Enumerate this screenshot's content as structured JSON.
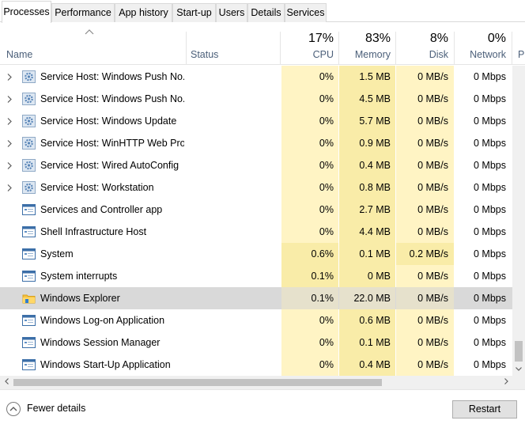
{
  "tabs": [
    {
      "label": "Processes",
      "active": true
    },
    {
      "label": "Performance",
      "active": false
    },
    {
      "label": "App history",
      "active": false
    },
    {
      "label": "Start-up",
      "active": false
    },
    {
      "label": "Users",
      "active": false
    },
    {
      "label": "Details",
      "active": false
    },
    {
      "label": "Services",
      "active": false
    }
  ],
  "header": {
    "name": "Name",
    "status": "Status",
    "cpu": {
      "pct": "17%",
      "label": "CPU"
    },
    "memory": {
      "pct": "83%",
      "label": "Memory"
    },
    "disk": {
      "pct": "8%",
      "label": "Disk"
    },
    "network": {
      "pct": "0%",
      "label": "Network"
    },
    "partial": "P"
  },
  "rows": [
    {
      "name": "Service Host: Windows Push No...",
      "expandable": true,
      "icon": "gear-icon",
      "cpu": "0%",
      "memory": "1.5 MB",
      "disk": "0 MB/s",
      "network": "0 Mbps"
    },
    {
      "name": "Service Host: Windows Push No...",
      "expandable": true,
      "icon": "gear-icon",
      "cpu": "0%",
      "memory": "4.5 MB",
      "disk": "0 MB/s",
      "network": "0 Mbps"
    },
    {
      "name": "Service Host: Windows Update",
      "expandable": true,
      "icon": "gear-icon",
      "cpu": "0%",
      "memory": "5.7 MB",
      "disk": "0 MB/s",
      "network": "0 Mbps"
    },
    {
      "name": "Service Host: WinHTTP Web Pro...",
      "expandable": true,
      "icon": "gear-icon",
      "cpu": "0%",
      "memory": "0.9 MB",
      "disk": "0 MB/s",
      "network": "0 Mbps"
    },
    {
      "name": "Service Host: Wired AutoConfig",
      "expandable": true,
      "icon": "gear-icon",
      "cpu": "0%",
      "memory": "0.4 MB",
      "disk": "0 MB/s",
      "network": "0 Mbps"
    },
    {
      "name": "Service Host: Workstation",
      "expandable": true,
      "icon": "gear-icon",
      "cpu": "0%",
      "memory": "0.8 MB",
      "disk": "0 MB/s",
      "network": "0 Mbps"
    },
    {
      "name": "Services and Controller app",
      "expandable": false,
      "icon": "window-icon",
      "cpu": "0%",
      "memory": "2.7 MB",
      "disk": "0 MB/s",
      "network": "0 Mbps"
    },
    {
      "name": "Shell Infrastructure Host",
      "expandable": false,
      "icon": "window-icon",
      "cpu": "0%",
      "memory": "4.4 MB",
      "disk": "0 MB/s",
      "network": "0 Mbps"
    },
    {
      "name": "System",
      "expandable": false,
      "icon": "window-icon",
      "cpu": "0.6%",
      "memory": "0.1 MB",
      "disk": "0.2 MB/s",
      "network": "0 Mbps"
    },
    {
      "name": "System interrupts",
      "expandable": false,
      "icon": "window-icon",
      "cpu": "0.1%",
      "memory": "0 MB",
      "disk": "0 MB/s",
      "network": "0 Mbps"
    },
    {
      "name": "Windows Explorer",
      "expandable": false,
      "icon": "folder-icon",
      "selected": true,
      "cpu": "0.1%",
      "memory": "22.0 MB",
      "disk": "0 MB/s",
      "network": "0 Mbps"
    },
    {
      "name": "Windows Log-on Application",
      "expandable": false,
      "icon": "window-icon",
      "cpu": "0%",
      "memory": "0.6 MB",
      "disk": "0 MB/s",
      "network": "0 Mbps"
    },
    {
      "name": "Windows Session Manager",
      "expandable": false,
      "icon": "window-icon",
      "cpu": "0%",
      "memory": "0.1 MB",
      "disk": "0 MB/s",
      "network": "0 Mbps"
    },
    {
      "name": "Windows Start-Up Application",
      "expandable": false,
      "icon": "window-icon",
      "cpu": "0%",
      "memory": "0.4 MB",
      "disk": "0 MB/s",
      "network": "0 Mbps"
    }
  ],
  "colors": {
    "heat_light": "#fff4c4",
    "heat_medium": "#f9eca8",
    "selected_row": "#d9d9d9",
    "header_label": "#4c607a"
  },
  "footer": {
    "fewer_details": "Fewer details",
    "restart": "Restart"
  }
}
